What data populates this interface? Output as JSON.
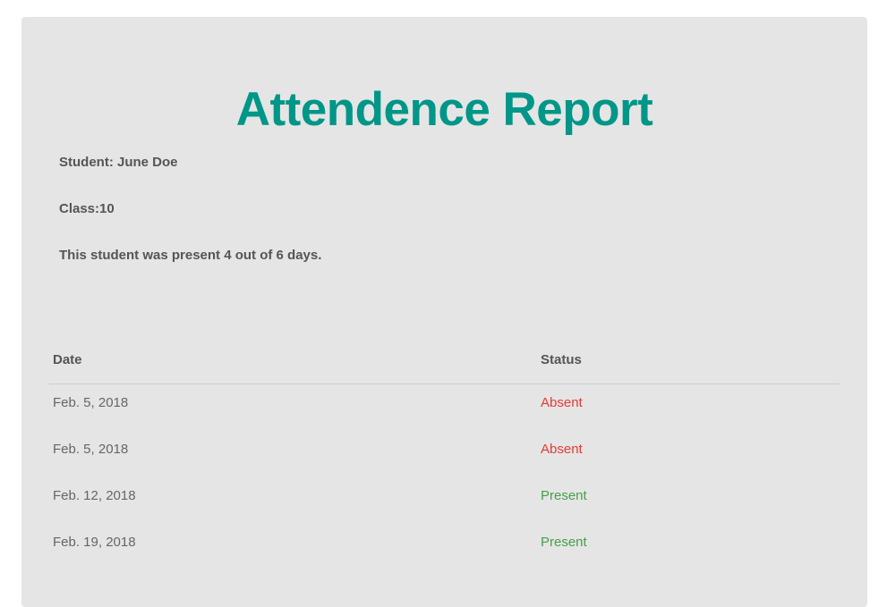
{
  "report": {
    "title": "Attendence Report",
    "student_line": "Student: June Doe",
    "class_line": "Class:10",
    "summary_line": "This student was present 4 out of 6 days."
  },
  "colors": {
    "title": "#009688",
    "absent": "#e53935",
    "present": "#43a047"
  },
  "table": {
    "headers": {
      "date": "Date",
      "status": "Status"
    },
    "rows": [
      {
        "date": "Feb. 5, 2018",
        "status": "Absent"
      },
      {
        "date": "Feb. 5, 2018",
        "status": "Absent"
      },
      {
        "date": "Feb. 12, 2018",
        "status": "Present"
      },
      {
        "date": "Feb. 19, 2018",
        "status": "Present"
      }
    ]
  }
}
